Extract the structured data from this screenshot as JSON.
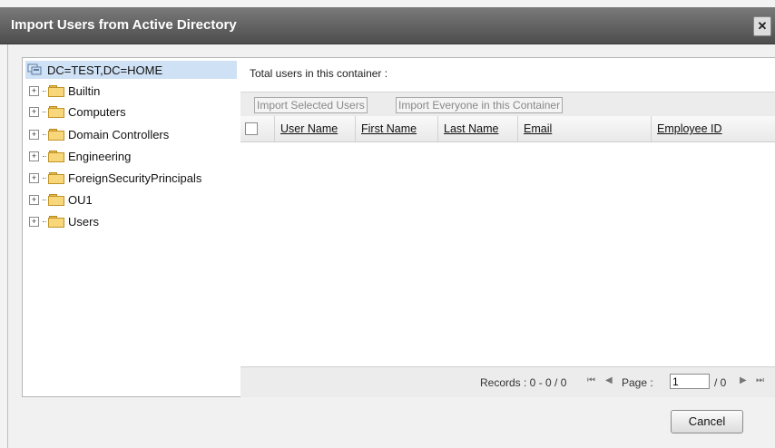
{
  "dialog": {
    "title": "Import Users from Active Directory",
    "close_glyph": "✕"
  },
  "tree": {
    "root": {
      "label": "DC=TEST,DC=HOME",
      "icon": "server-icon"
    },
    "expander_glyph": "+",
    "children": [
      {
        "label": "Builtin"
      },
      {
        "label": "Computers"
      },
      {
        "label": "Domain Controllers"
      },
      {
        "label": "Engineering"
      },
      {
        "label": "ForeignSecurityPrincipals"
      },
      {
        "label": "OU1"
      },
      {
        "label": "Users"
      }
    ]
  },
  "content": {
    "total_label": "Total users in this container :",
    "buttons": {
      "import_selected": "Import Selected Users",
      "import_everyone": "Import Everyone in this Container"
    },
    "columns": [
      "User Name",
      "First Name",
      "Last Name",
      "Email",
      "Employee ID"
    ],
    "pager": {
      "records": "Records : 0 - 0 / 0",
      "page_label": "Page :",
      "page_value": "1",
      "of": "/ 0",
      "first_glyph": "⏮",
      "prev_glyph": "◀",
      "next_glyph": "▶",
      "last_glyph": "⏭"
    }
  },
  "footer": {
    "cancel": "Cancel"
  }
}
